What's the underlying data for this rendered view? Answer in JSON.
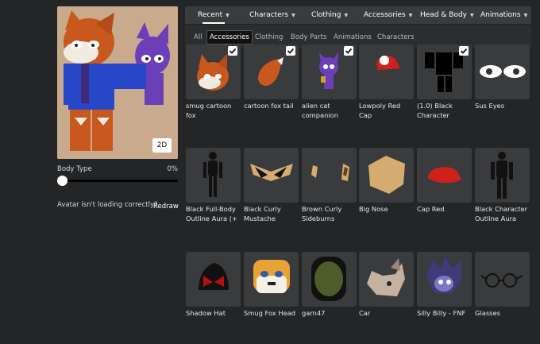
{
  "top_nav": [
    {
      "label": "Recent",
      "active": true
    },
    {
      "label": "Characters"
    },
    {
      "label": "Clothing"
    },
    {
      "label": "Accessories"
    },
    {
      "label": "Head & Body"
    },
    {
      "label": "Animations"
    }
  ],
  "sub_nav": [
    {
      "label": "All"
    },
    {
      "label": "Accessories",
      "active": true
    },
    {
      "label": "Clothing"
    },
    {
      "label": "Body Parts"
    },
    {
      "label": "Animations"
    },
    {
      "label": "Characters"
    }
  ],
  "avatar_panel": {
    "view_toggle": "2D",
    "body_type_label": "Body Type",
    "body_type_value": "0%",
    "body_type_level": 0,
    "loading_message": "Avatar isn't loading correctly?",
    "redraw_label": "Redraw"
  },
  "items": [
    {
      "name": "smug cartoon fox",
      "equipped": true,
      "icon": "fox-head-icon"
    },
    {
      "name": "cartoon fox tail",
      "equipped": true,
      "icon": "fox-tail-icon"
    },
    {
      "name": "alien cat companion",
      "equipped": true,
      "icon": "alien-cat-icon"
    },
    {
      "name": "Lowpoly Red Cap",
      "equipped": false,
      "icon": "red-cap-icon"
    },
    {
      "name": "(1.0) Black Character",
      "equipped": true,
      "icon": "black-character-icon"
    },
    {
      "name": "Sus Eyes",
      "equipped": false,
      "icon": "eyes-icon"
    },
    {
      "name": "Black Full-Body Outline Aura (+",
      "equipped": false,
      "icon": "outline-figure-icon"
    },
    {
      "name": "Black Curly Mustache",
      "equipped": false,
      "icon": "mustache-icon"
    },
    {
      "name": "Brown Curly Sideburns",
      "equipped": false,
      "icon": "sideburns-icon"
    },
    {
      "name": "Big Nose",
      "equipped": false,
      "icon": "nose-icon"
    },
    {
      "name": "Cap Red",
      "equipped": false,
      "icon": "cap-icon"
    },
    {
      "name": "Black Character Outline Aura",
      "equipped": false,
      "icon": "outline-figure-icon"
    },
    {
      "name": "Shadow Hat",
      "equipped": false,
      "icon": "hat-icon"
    },
    {
      "name": "Smug Fox Head",
      "equipped": false,
      "icon": "fox-head-icon"
    },
    {
      "name": "garn47",
      "equipped": false,
      "icon": "face-icon"
    },
    {
      "name": "Car",
      "equipped": false,
      "icon": "cat-head-icon"
    },
    {
      "name": "Silly Billy - FNF",
      "equipped": false,
      "icon": "hair-icon"
    },
    {
      "name": "Glasses",
      "equipped": false,
      "icon": "glasses-icon"
    }
  ],
  "colors": {
    "background": "#232527",
    "tile": "#393b3d",
    "nav": "#393b3d"
  }
}
